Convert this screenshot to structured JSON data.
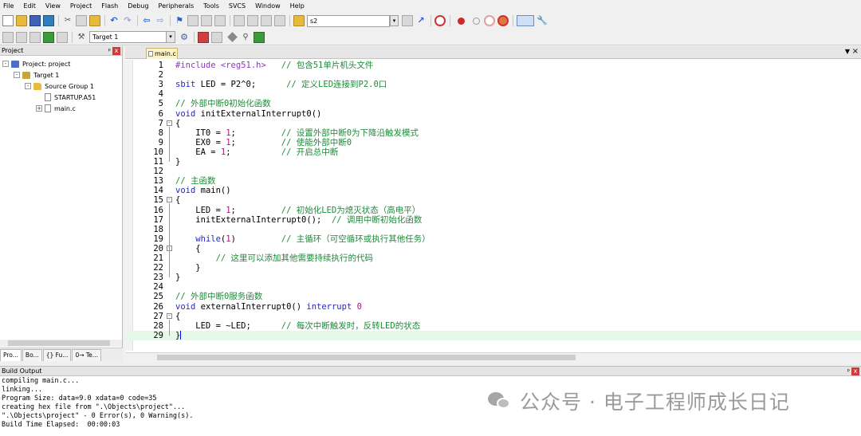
{
  "menu": [
    "File",
    "Edit",
    "View",
    "Project",
    "Flash",
    "Debug",
    "Peripherals",
    "Tools",
    "SVCS",
    "Window",
    "Help"
  ],
  "toolbar": {
    "find_combo_value": "s2",
    "target_combo_value": "Target 1"
  },
  "project_panel": {
    "title": "Project",
    "pin": "ᵖ",
    "close": "x",
    "tree": [
      {
        "label": "Project: project",
        "level": 0,
        "icon": "project-icon",
        "toggle": "-"
      },
      {
        "label": "Target 1",
        "level": 1,
        "icon": "target-icon",
        "toggle": "-"
      },
      {
        "label": "Source Group 1",
        "level": 2,
        "icon": "folder-icon",
        "toggle": "-"
      },
      {
        "label": "STARTUP.A51",
        "level": 3,
        "icon": "file-icon",
        "toggle": ""
      },
      {
        "label": "main.c",
        "level": 3,
        "icon": "file-icon",
        "toggle": "+"
      }
    ],
    "tabs": [
      "Pro...",
      "Bo...",
      "{} Fu...",
      "0→ Te..."
    ]
  },
  "editor": {
    "tab_label": "main.c",
    "lines": [
      {
        "n": "1",
        "fold": "",
        "parts": [
          [
            "pp",
            "#include <reg51.h>"
          ],
          [
            "",
            "   "
          ],
          [
            "cm",
            "// 包含51单片机头文件"
          ]
        ]
      },
      {
        "n": "2",
        "fold": "",
        "parts": []
      },
      {
        "n": "3",
        "fold": "",
        "parts": [
          [
            "kw",
            "sbit"
          ],
          [
            "",
            " LED = P2^0;      "
          ],
          [
            "cm",
            "// 定义LED连接到P2.0口"
          ]
        ]
      },
      {
        "n": "4",
        "fold": "",
        "parts": []
      },
      {
        "n": "5",
        "fold": "",
        "parts": [
          [
            "cm",
            "// 外部中断0初始化函数"
          ]
        ]
      },
      {
        "n": "6",
        "fold": "",
        "parts": [
          [
            "kw",
            "void"
          ],
          [
            "",
            " initExternalInterrupt0()"
          ]
        ]
      },
      {
        "n": "7",
        "fold": "-",
        "parts": [
          [
            "",
            "{"
          ]
        ]
      },
      {
        "n": "8",
        "fold": "",
        "parts": [
          [
            "",
            "    IT0 = "
          ],
          [
            "num",
            "1"
          ],
          [
            "",
            ";         "
          ],
          [
            "cm",
            "// 设置外部中断0为下降沿触发模式"
          ]
        ]
      },
      {
        "n": "9",
        "fold": "",
        "parts": [
          [
            "",
            "    EX0 = "
          ],
          [
            "num",
            "1"
          ],
          [
            "",
            ";         "
          ],
          [
            "cm",
            "// 使能外部中断0"
          ]
        ]
      },
      {
        "n": "10",
        "fold": "",
        "parts": [
          [
            "",
            "    EA = "
          ],
          [
            "num",
            "1"
          ],
          [
            "",
            ";          "
          ],
          [
            "cm",
            "// 开启总中断"
          ]
        ]
      },
      {
        "n": "11",
        "fold": "",
        "parts": [
          [
            "",
            "}"
          ]
        ]
      },
      {
        "n": "12",
        "fold": "",
        "parts": []
      },
      {
        "n": "13",
        "fold": "",
        "parts": [
          [
            "cm",
            "// 主函数"
          ]
        ]
      },
      {
        "n": "14",
        "fold": "",
        "parts": [
          [
            "kw",
            "void"
          ],
          [
            "",
            " main()"
          ]
        ]
      },
      {
        "n": "15",
        "fold": "-",
        "parts": [
          [
            "",
            "{"
          ]
        ]
      },
      {
        "n": "16",
        "fold": "",
        "parts": [
          [
            "",
            "    LED = "
          ],
          [
            "num",
            "1"
          ],
          [
            "",
            ";         "
          ],
          [
            "cm",
            "// 初始化LED为熄灭状态（高电平）"
          ]
        ]
      },
      {
        "n": "17",
        "fold": "",
        "parts": [
          [
            "",
            "    initExternalInterrupt0();  "
          ],
          [
            "cm",
            "// 调用中断初始化函数"
          ]
        ]
      },
      {
        "n": "18",
        "fold": "",
        "parts": []
      },
      {
        "n": "19",
        "fold": "",
        "parts": [
          [
            "",
            "    "
          ],
          [
            "kw",
            "while"
          ],
          [
            "",
            "("
          ],
          [
            "num",
            "1"
          ],
          [
            "",
            ")         "
          ],
          [
            "cm",
            "// 主循环（可空循环或执行其他任务）"
          ]
        ]
      },
      {
        "n": "20",
        "fold": "-",
        "parts": [
          [
            "",
            "    {"
          ]
        ]
      },
      {
        "n": "21",
        "fold": "",
        "parts": [
          [
            "",
            "        "
          ],
          [
            "cm",
            "// 这里可以添加其他需要持续执行的代码"
          ]
        ]
      },
      {
        "n": "22",
        "fold": "",
        "parts": [
          [
            "",
            "    }"
          ]
        ]
      },
      {
        "n": "23",
        "fold": "",
        "parts": [
          [
            "",
            "}"
          ]
        ]
      },
      {
        "n": "24",
        "fold": "",
        "parts": []
      },
      {
        "n": "25",
        "fold": "",
        "parts": [
          [
            "cm",
            "// 外部中断0服务函数"
          ]
        ]
      },
      {
        "n": "26",
        "fold": "",
        "parts": [
          [
            "kw",
            "void"
          ],
          [
            "",
            " externalInterrupt0() "
          ],
          [
            "kw",
            "interrupt"
          ],
          [
            "",
            " "
          ],
          [
            "num",
            "0"
          ]
        ]
      },
      {
        "n": "27",
        "fold": "-",
        "parts": [
          [
            "",
            "{"
          ]
        ]
      },
      {
        "n": "28",
        "fold": "",
        "parts": [
          [
            "",
            "    LED = ~LED;      "
          ],
          [
            "cm",
            "// 每次中断触发时，反转LED的状态"
          ]
        ]
      },
      {
        "n": "29",
        "fold": "",
        "parts": [
          [
            "",
            "}"
          ]
        ],
        "highlight": true
      }
    ]
  },
  "build_output": {
    "title": "Build Output",
    "lines": [
      "compiling main.c...",
      "linking...",
      "Program Size: data=9.0 xdata=0 code=35",
      "creating hex file from \".\\Objects\\project\"...",
      "\".\\Objects\\project\" - 0 Error(s), 0 Warning(s).",
      "Build Time Elapsed:  00:00:03"
    ]
  },
  "watermark": {
    "text": "公众号 · 电子工程师成长日记"
  }
}
